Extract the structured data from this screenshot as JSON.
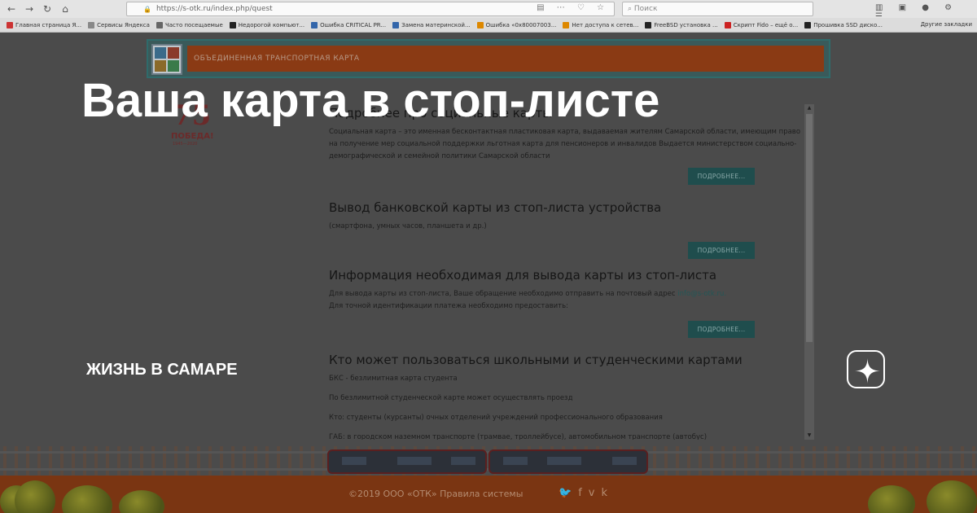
{
  "browser": {
    "url": "https://s-otk.ru/index.php/quest",
    "search_placeholder": "Поиск",
    "bookmarks": [
      "Главная страница Я...",
      "Сервисы Яндекса",
      "Часто посещаемые",
      "Недорогой компьют...",
      "Ошибка CRITICAL PR...",
      "Замена материнской...",
      "Ошибка «0x80007003...",
      "Нет доступа к сетев...",
      "FreeBSD установка ...",
      "Скрипт Fido – ещё о...",
      "Прошивка SSD диско..."
    ],
    "other_bookmarks": "Другие закладки"
  },
  "site": {
    "header_title": "ОБЪЕДИНЕННАЯ ТРАНСПОРТНАЯ КАРТА",
    "victory_number": "75",
    "victory_text": "ПОБЕДА!",
    "victory_years": "1945—2020",
    "sections": [
      {
        "title": "Подробнее про социальные карты",
        "text": "Социальная карта – это именная бесконтактная пластиковая карта, выдаваемая жителям Самарской области, имеющим право на получение мер социальной поддержки льготная карта для пенсионеров и инвалидов Выдается министерством социально-демографической и семейной политики Самарской области",
        "button": "ПОДРОБНЕЕ..."
      },
      {
        "title": "Вывод банковской карты из стоп-листа устройства",
        "text": "(смартфона, умных часов, планшета и др.)",
        "button": "ПОДРОБНЕЕ..."
      },
      {
        "title": "Информация необходимая для вывода карты из стоп-листа",
        "text": "Для вывода карты из стоп-листа, Ваше обращение необходимо отправить на почтовый адрес",
        "email": "info@s-otk.ru.",
        "text2": "Для точной идентификации платежа необходимо предоставить:",
        "button": "ПОДРОБНЕЕ..."
      },
      {
        "title": "Кто может пользоваться школьными и студенческими картами",
        "line1": "БКС - безлимитная карта студента",
        "line2": "По безлимитной студенческой карте может осуществлять проезд",
        "line3_label": "Кто:",
        "line3": "студенты (курсанты) очных отделений учреждений профессионального образования",
        "line4": "ГАБ: в городском наземном транспорте (трамвае, троллейбусе), автомобильном транспорте (автобус)"
      }
    ],
    "footer_copy": "©2019 ООО «ОТК»  Правила системы"
  },
  "overlay": {
    "headline": "Ваша карта в стоп-листе",
    "channel": "ЖИЗНЬ В САМАРЕ"
  }
}
